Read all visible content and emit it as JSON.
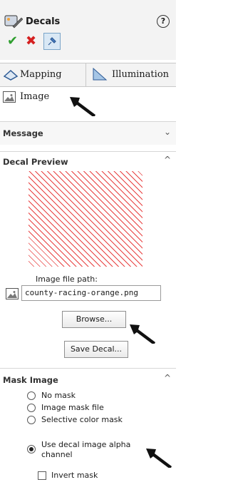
{
  "header": {
    "title": "Decals",
    "help_icon": "question-circle-icon",
    "ok_icon": "checkmark-icon",
    "cancel_icon": "x-icon",
    "pin_icon": "pushpin-icon"
  },
  "tabs": [
    {
      "label": "Mapping",
      "icon": "mapping-icon"
    },
    {
      "label": "Illumination",
      "icon": "illumination-icon"
    }
  ],
  "image_row": {
    "label": "Image"
  },
  "sections": {
    "message": {
      "title": "Message",
      "chevron": "⌄"
    },
    "decal_preview": {
      "title": "Decal Preview",
      "chevron": "^",
      "image_file_path_label": "Image file path:",
      "image_file_path_value": "county-racing-orange.png",
      "browse_button": "Browse...",
      "save_button": "Save Decal..."
    },
    "mask_image": {
      "title": "Mask Image",
      "chevron": "^",
      "options": [
        {
          "label": "No mask",
          "selected": false
        },
        {
          "label": "Image mask file",
          "selected": false
        },
        {
          "label": "Selective color mask",
          "selected": false
        },
        {
          "label": "Use decal image alpha channel",
          "selected": true
        }
      ],
      "invert_mask_label": "Invert mask"
    }
  },
  "colors": {
    "ok": "#2e9e2e",
    "cancel": "#d52020",
    "preview_hatch": "#e84040"
  }
}
